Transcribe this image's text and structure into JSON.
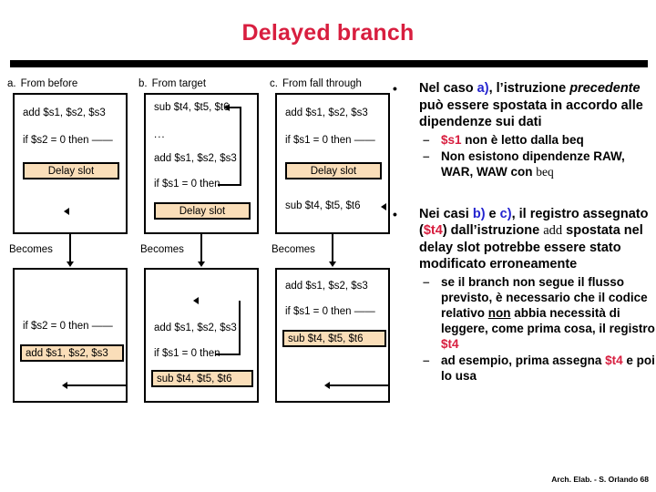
{
  "slide": {
    "title": "Delayed branch",
    "footer": "Arch. Elab. - S. Orlando 68"
  },
  "diagram": {
    "becomes_label": "Becomes",
    "delay_slot_label": "Delay slot",
    "ellipsis": "...",
    "columns": [
      {
        "letter": "a.",
        "caption": "From before",
        "top_box": {
          "lines": [
            "add $s1, $s2, $s3",
            "if $s2 = 0 then ——"
          ],
          "delay_slot": "Delay slot"
        },
        "bottom_box": {
          "lines": [
            "if $s2 = 0 then ——"
          ],
          "highlighted": "add $s1, $s2, $s3"
        }
      },
      {
        "letter": "b.",
        "caption": "From target",
        "top_box": {
          "lines": [
            "sub $t4, $t5, $t6",
            "...",
            "add $s1, $s2, $s3",
            "if $s1 = 0 then"
          ],
          "delay_slot": "Delay slot"
        },
        "bottom_box": {
          "lines": [
            "add $s1, $s2, $s3",
            "if $s1 = 0 then"
          ],
          "highlighted": "sub $t4, $t5, $t6"
        }
      },
      {
        "letter": "c.",
        "caption": "From fall through",
        "top_box": {
          "lines": [
            "add $s1, $s2, $s3",
            "if $s1 = 0 then ——",
            "sub $t4, $t5, $t6"
          ],
          "delay_slot": "Delay slot"
        },
        "bottom_box": {
          "lines": [
            "add $s1, $s2, $s3",
            "if $s1 = 0 then ——"
          ],
          "highlighted": "sub $t4, $t5, $t6"
        }
      }
    ]
  },
  "text": {
    "bullet_glyph": "•",
    "dash_glyph": "–",
    "b1": {
      "p1": "Nel caso ",
      "case_a": "a)",
      "p2": ", l’istruzione ",
      "em": "precedente",
      "p3": " può essere spostata in accordo alle dipendenze sui dati",
      "sub1_reg": "$s1",
      "sub1_rest": " non è letto dalla beq",
      "sub2_pre": "Non esistono dipendenze RAW, WAR, WAW con ",
      "sub2_mono": "beq"
    },
    "b2": {
      "p1": "Nei casi ",
      "case_b": "b)",
      "p2": " e ",
      "case_c": "c)",
      "p3": ", il registro assegnato (",
      "reg": "$t4",
      "p4": ") dall’istruzione ",
      "mono": "add",
      "p5": " spostata nel delay slot potrebbe essere stato modificato erroneamente",
      "sub1_a": "se il branch non segue il flusso previsto, è necessario che il codice relativo ",
      "sub1_non": "non",
      "sub1_b": " abbia necessità di leggere, come prima cosa, il registro ",
      "sub1_reg": "$t4",
      "sub2_a": "ad esempio, prima assegna ",
      "sub2_reg": "$t4",
      "sub2_b": " e poi lo usa"
    }
  },
  "colors": {
    "title_red": "#D81E3F",
    "highlight_peach": "#FADEB9",
    "case_blue": "#2424CF",
    "register_red": "#D81E3F"
  }
}
